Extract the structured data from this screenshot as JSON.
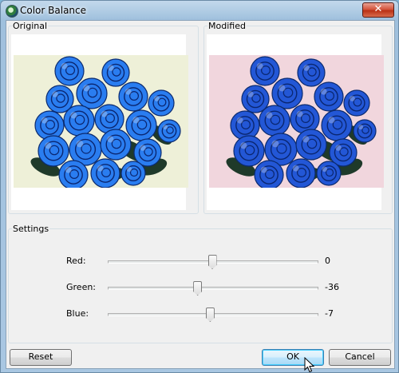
{
  "window": {
    "title": "Color Balance",
    "close_label": "✕"
  },
  "panels": {
    "original_label": "Original",
    "modified_label": "Modified"
  },
  "settings": {
    "label": "Settings",
    "sliders": [
      {
        "label": "Red:",
        "value": "0",
        "level": 0.5
      },
      {
        "label": "Green:",
        "value": "-36",
        "level": 0.43
      },
      {
        "label": "Blue:",
        "value": "-7",
        "level": 0.49
      }
    ]
  },
  "buttons": {
    "reset": "Reset",
    "ok": "OK",
    "cancel": "Cancel"
  },
  "colors": {
    "original_bg": "#eef0d8",
    "modified_bg": "#f1d6dd",
    "rose_original": "#2a7df0",
    "rose_modified": "#2357d6",
    "leaf": "#1f3a2a"
  }
}
